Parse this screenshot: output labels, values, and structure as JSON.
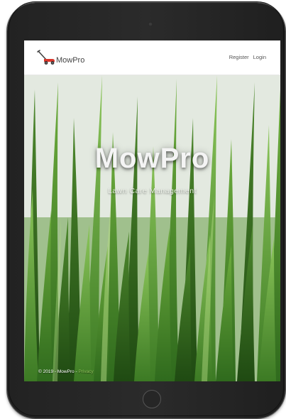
{
  "nav": {
    "brand": "MowPro",
    "register": "Register",
    "login": "Login"
  },
  "hero": {
    "title": "MowPro",
    "subtitle": "Lawn Care Management"
  },
  "footer": {
    "copyright": "© 2019 - MowPro - ",
    "privacy": "Privacy"
  },
  "colors": {
    "mower_red": "#d9362b",
    "grass_green": "#4f8a2e",
    "privacy_link": "#8fbf5a"
  },
  "icons": {
    "brand_logo": "lawn-mower-icon"
  }
}
